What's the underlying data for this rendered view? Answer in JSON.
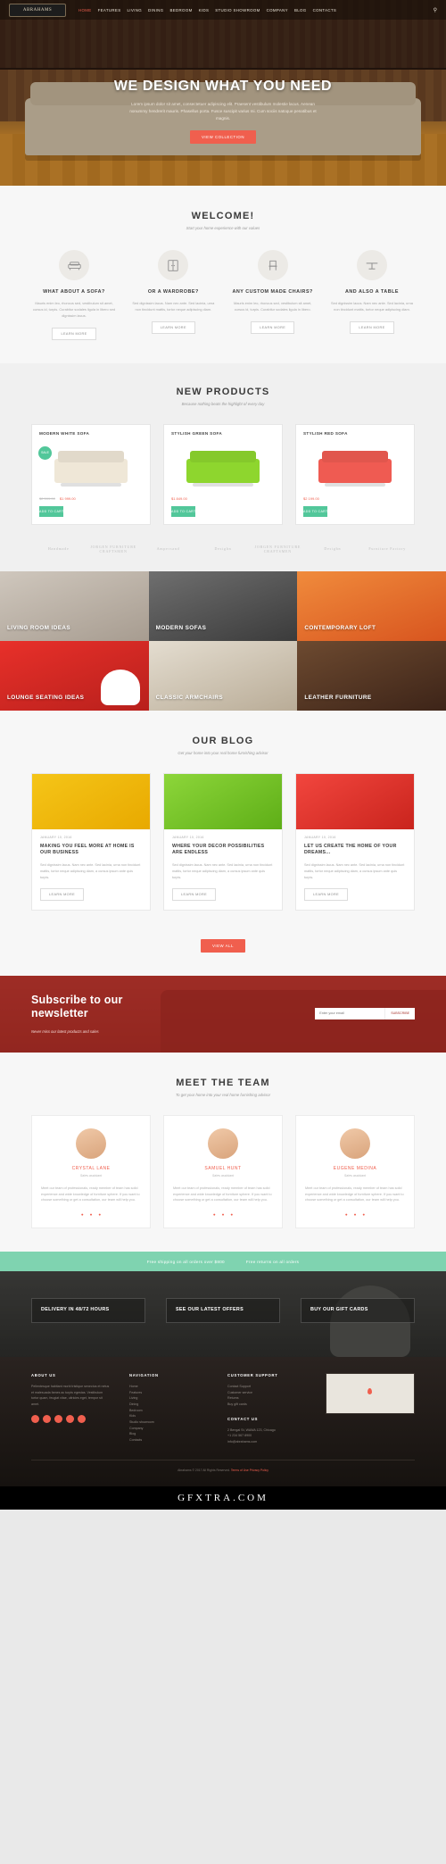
{
  "header": {
    "logo": "ABRAHAMS",
    "nav": [
      "HOME",
      "FEATURES",
      "LIVING",
      "DINING",
      "BEDROOM",
      "KIDS",
      "STUDIO SHOWROOM",
      "COMPANY",
      "BLOG",
      "CONTACTS"
    ],
    "active_nav": "HOME",
    "search_icon": "search-icon"
  },
  "hero": {
    "title": "WE DESIGN WHAT YOU NEED",
    "paragraph": "Lorem ipsum dolor sit amet, consectetuer adipiscing elit. Praesent vestibulum molestie lacus. Aenean nonummy hendrerit mauris. Phasellus porta. Fusce suscipit varius mi. Cum sociis natoque penatibus et magnis.",
    "cta": "VIEW COLLECTION"
  },
  "welcome": {
    "title": "WELCOME!",
    "subtitle": "Start your home experience with our values",
    "features": [
      {
        "icon": "sofa-icon",
        "title": "WHAT ABOUT A SOFA?",
        "text": "Mauris enim leo, rhoncus sed, vestibulum sit amet, cursus id, turpis. Curabitur sodales ligula in libero sed dignissim lacus.",
        "button": "LEARN MORE"
      },
      {
        "icon": "wardrobe-icon",
        "title": "OR A WARDROBE?",
        "text": "Sed dignissim lacus. Nam nec ante. Sed lacinia, urna non tincidunt mattis, tortor neque adipiscing diam.",
        "button": "LEARN MORE"
      },
      {
        "icon": "chair-icon",
        "title": "ANY CUSTOM MADE CHAIRS?",
        "text": "Mauris enim leo, rhoncus sed, vestibulum sit amet, cursus id, turpis. Curabitur sodales ligula in libero.",
        "button": "LEARN MORE"
      },
      {
        "icon": "table-icon",
        "title": "AND ALSO A TABLE",
        "text": "Sed dignissim lacus. Nam nec ante. Sed lacinia, urna non tincidunt mattis, tortor neque adipiscing diam.",
        "button": "LEARN MORE"
      }
    ]
  },
  "products": {
    "title": "NEW PRODUCTS",
    "subtitle": "Because nothing beats the highlight of every day",
    "items": [
      {
        "name": "MODERN WHITE SOFA",
        "badge": "SALE",
        "price_old": "$2 599.00",
        "price_new": "$1 999.00",
        "button": "ADD TO CART",
        "color": "#efe7d7"
      },
      {
        "name": "STYLISH GREEN SOFA",
        "badge": "",
        "price_old": "",
        "price_new": "$1 849.00",
        "button": "ADD TO CART",
        "color": "#8ed62e"
      },
      {
        "name": "STYLISH RED SOFA",
        "badge": "",
        "price_old": "",
        "price_new": "$2 199.00",
        "button": "ADD TO CART",
        "color": "#ef5b52"
      }
    ],
    "brands": [
      "Handmade",
      "JORGEN FURNITURE CRAFTSMEN",
      "Ampersand",
      "Desighn",
      "JORGEN FURNITURE CRAFTSMEN",
      "Desighn",
      "Furniture Factory"
    ]
  },
  "categories": [
    {
      "label": "LIVING ROOM IDEAS"
    },
    {
      "label": "MODERN SOFAS"
    },
    {
      "label": "CONTEMPORARY LOFT"
    },
    {
      "label": "LOUNGE SEATING IDEAS"
    },
    {
      "label": "CLASSIC ARMCHAIRS"
    },
    {
      "label": "LEATHER FURNITURE"
    }
  ],
  "blog": {
    "title": "OUR BLOG",
    "subtitle": "Get your home into your real home furnishing advisor",
    "posts": [
      {
        "date": "JANUARY 10, 2016",
        "title": "MAKING YOU FEEL MORE AT HOME IS OUR BUSINESS",
        "text": "Sed dignissim lacus. Nam nec ante. Sed lacinia, urna non tincidunt mattis, tortor neque adipiscing diam, a cursus ipsum ante quis turpis.",
        "button": "LEARN MORE"
      },
      {
        "date": "JANUARY 10, 2016",
        "title": "WHERE YOUR DECOR POSSIBILITIES ARE ENDLESS",
        "text": "Sed dignissim lacus. Nam nec ante. Sed lacinia, urna non tincidunt mattis, tortor neque adipiscing diam, a cursus ipsum ante quis turpis.",
        "button": "LEARN MORE"
      },
      {
        "date": "JANUARY 10, 2016",
        "title": "LET US CREATE THE HOME OF YOUR DREAMS...",
        "text": "Sed dignissim lacus. Nam nec ante. Sed lacinia, urna non tincidunt mattis, tortor neque adipiscing diam, a cursus ipsum ante quis turpis.",
        "button": "LEARN MORE"
      }
    ],
    "view_all": "VIEW ALL"
  },
  "newsletter": {
    "title_line1": "Subscribe to our",
    "title_line2": "newsletter",
    "tagline": "Never miss our latest products and sales",
    "input_placeholder": "Enter your email",
    "button": "SUBSCRIBE"
  },
  "team": {
    "title": "MEET THE TEAM",
    "subtitle": "To get your home into your real home furnishing advisor",
    "members": [
      {
        "name": "CRYSTAL LANE",
        "role": "Sales assistant",
        "bio": "Meet our team of professionals, ready member of team has solid experience and wide knowledge of furniture sphere. If you want to choose something or get a consultation, our team will help you.",
        "socials": [
          "twitter-icon",
          "facebook-icon",
          "gplus-icon"
        ]
      },
      {
        "name": "SAMUEL HUNT",
        "role": "Sales assistant",
        "bio": "Meet our team of professionals, ready member of team has solid experience and wide knowledge of furniture sphere. If you want to choose something or get a consultation, our team will help you.",
        "socials": [
          "twitter-icon",
          "facebook-icon",
          "gplus-icon"
        ]
      },
      {
        "name": "EUGENE MEDINA",
        "role": "Sales assistant",
        "bio": "Meet our team of professionals, ready member of team has solid experience and wide knowledge of furniture sphere. If you want to choose something or get a consultation, our team will help you.",
        "socials": [
          "twitter-icon",
          "facebook-icon",
          "gplus-icon"
        ]
      }
    ]
  },
  "shipping": {
    "left": "Free shipping on all orders over $800",
    "right": "Free returns on all orders"
  },
  "promo": [
    {
      "title": "DELIVERY IN 48/72 HOURS"
    },
    {
      "title": "SEE OUR LATEST OFFERS"
    },
    {
      "title": "BUY OUR GIFT CARDS"
    }
  ],
  "footer": {
    "about": {
      "heading": "ABOUT US",
      "text": "Pellentesque habitant morbi tristique senectus et netus et malesuada fames ac turpis egestas. Vestibulum tortor quam, feugiat vitae, ultricies eget, tempor sit amet."
    },
    "navigation": {
      "heading": "NAVIGATION",
      "items": [
        "Home",
        "Features",
        "Living",
        "Dining",
        "Bedroom",
        "Kids",
        "Studio showroom",
        "Company",
        "Blog",
        "Contacts"
      ]
    },
    "support": {
      "heading": "CUSTOMER SUPPORT",
      "items": [
        "Contact Support",
        "Customer service",
        "Returns",
        "Buy gift cards"
      ]
    },
    "contact": {
      "heading": "CONTACT US",
      "items": [
        "2 Bengal St, WAWA 123, Chicago",
        "+1 234 567 8900",
        "info@abrahams.com"
      ]
    },
    "socials": [
      "twitter-icon",
      "facebook-icon",
      "gplus-icon",
      "rss-icon",
      "pinterest-icon"
    ],
    "map_label": "map-pin-icon",
    "copyright": "Abrahams © 2017 All Rights Reserved.",
    "copyright_links": [
      "Terms of Use",
      "Privacy Policy"
    ]
  },
  "watermark": "GFXTRA.COM"
}
